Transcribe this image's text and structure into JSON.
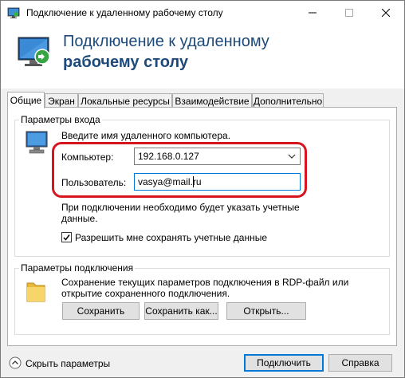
{
  "window": {
    "title": "Подключение к удаленному рабочему столу"
  },
  "header": {
    "line1": "Подключение к удаленному",
    "line2": "рабочему столу"
  },
  "tabs": [
    {
      "label": "Общие",
      "active": true
    },
    {
      "label": "Экран",
      "active": false
    },
    {
      "label": "Локальные ресурсы",
      "active": false
    },
    {
      "label": "Взаимодействие",
      "active": false
    },
    {
      "label": "Дополнительно",
      "active": false
    }
  ],
  "login_group": {
    "legend": "Параметры входа",
    "prompt": "Введите имя удаленного компьютера.",
    "computer_label": "Компьютер:",
    "computer_value": "192.168.0.127",
    "user_label": "Пользователь:",
    "user_value": "vasya@mail.ru",
    "note_line1": "При подключении необходимо будет указать учетные",
    "note_line2": "данные.",
    "save_creds_label": "Разрешить мне сохранять учетные данные",
    "save_creds_checked": true
  },
  "connection_group": {
    "legend": "Параметры подключения",
    "desc_line1": "Сохранение текущих параметров подключения в RDP-файл или",
    "desc_line2": "открытие сохраненного подключения.",
    "save_button": "Сохранить",
    "save_as_button": "Сохранить как...",
    "open_button": "Открыть..."
  },
  "footer": {
    "hide_options_label": "Скрыть параметры",
    "connect_button": "Подключить",
    "help_button": "Справка"
  },
  "colors": {
    "title_blue": "#1c4a7a",
    "highlight_red": "#d8141f",
    "focus_blue": "#0078d7"
  },
  "icons": {
    "app": "remote-desktop-icon",
    "computer": "computer-icon",
    "folder": "folder-icon",
    "collapse": "chevron-up-circle-icon",
    "dropdown": "chevron-down-icon"
  }
}
